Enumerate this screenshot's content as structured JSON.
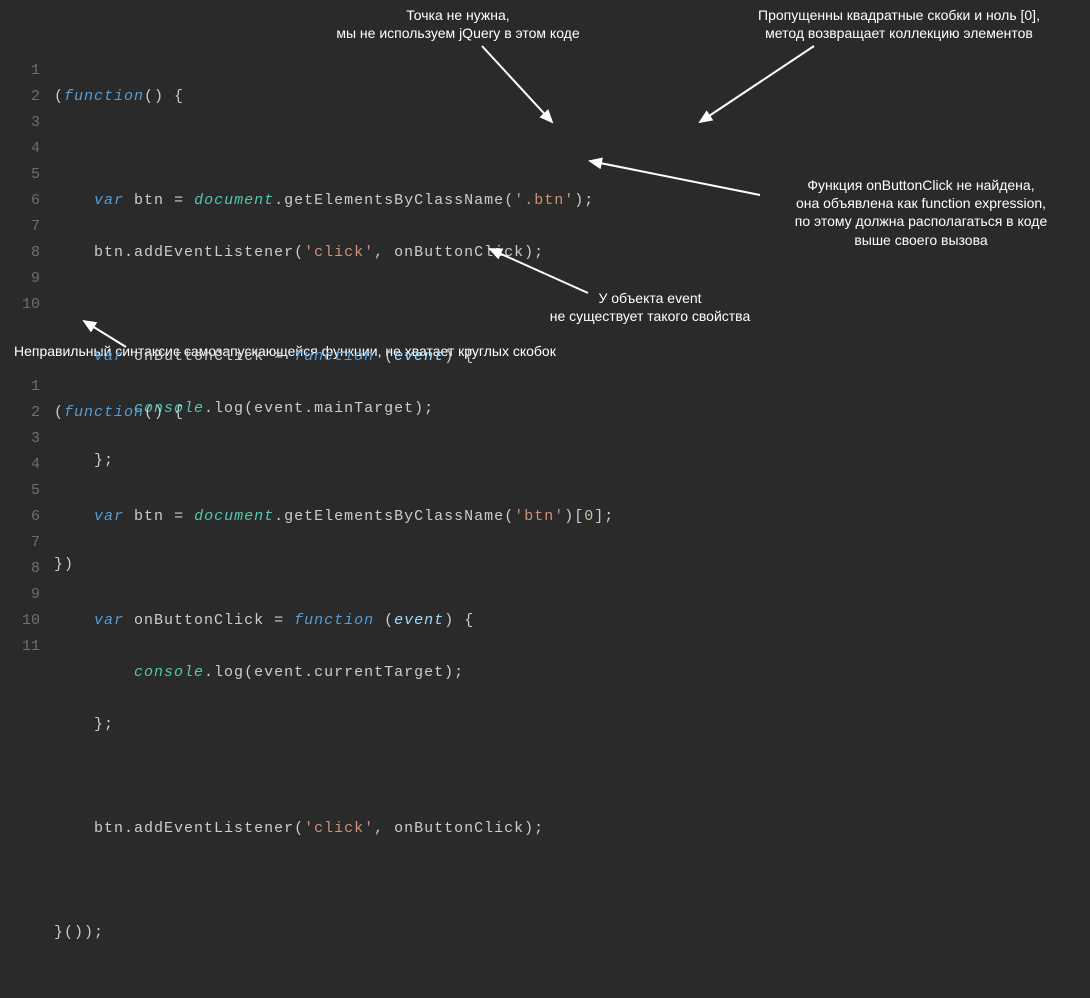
{
  "annotations": {
    "a1_l1": "Точка не нужна,",
    "a1_l2": "мы не используем jQuery в этом коде",
    "a2_l1": "Пропущенны квадратные скобки и ноль [0],",
    "a2_l2": "метод возвращает коллекцию элементов",
    "a3_l1": "Функция onButtonClick не найдена,",
    "a3_l2": "она объявлена как function expression,",
    "a3_l3": "по этому должна располагаться в коде",
    "a3_l4": "выше своего вызова",
    "a4_l1": "У объекта event",
    "a4_l2": "не существует такого свойства",
    "a5": "Неправильный синтаксис самозапускающейся функции, не хватает круглых скобок"
  },
  "code1": {
    "ln": [
      "1",
      "2",
      "3",
      "4",
      "5",
      "6",
      "7",
      "8",
      "9",
      "10"
    ],
    "t": {
      "kw_func": "function",
      "kw_var": "var",
      "btn": "btn",
      "eq": "=",
      "doc": "document",
      "getByCls": "getElementsByClassName",
      "dotBtn": "'.btn'",
      "addEv": "addEventListener",
      "click": "'click'",
      "onBtn": "onButtonClick",
      "event": "event",
      "console": "console",
      "log": "log",
      "mainTarget": "mainTarget"
    }
  },
  "code2": {
    "ln": [
      "1",
      "2",
      "3",
      "4",
      "5",
      "6",
      "7",
      "8",
      "9",
      "10",
      "11"
    ],
    "t": {
      "kw_func": "function",
      "kw_var": "var",
      "btn": "btn",
      "eq": "=",
      "doc": "document",
      "getByCls": "getElementsByClassName",
      "btnStr": "'btn'",
      "zero": "0",
      "onBtn": "onButtonClick",
      "event": "event",
      "console": "console",
      "log": "log",
      "curTarget": "currentTarget",
      "addEv": "addEventListener",
      "click": "'click'"
    }
  }
}
